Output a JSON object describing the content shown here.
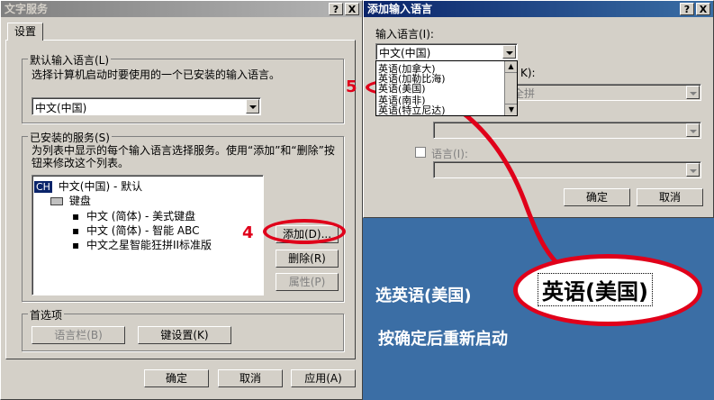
{
  "left_window": {
    "title": "文字服务",
    "title_buttons": [
      "?",
      "X"
    ],
    "tab": "设置",
    "default_lang": {
      "legend": "默认输入语言(L)",
      "description": "选择计算机启动时要使用的一个已安装的输入语言。",
      "value": "中文(中国)"
    },
    "installed": {
      "legend": "已安装的服务(S)",
      "description": "为列表中显示的每个输入语言选择服务。使用“添加”和“删除”按钮来修改这个列表。",
      "lang_code": "CH",
      "lang_name": "中文(中国) - 默认",
      "category": "键盘",
      "services": [
        "中文 (简体) - 美式键盘",
        "中文 (简体) - 智能 ABC",
        "中文之星智能狂拼II标准版"
      ],
      "add_label": "添加(D)...",
      "remove_label": "删除(R)",
      "props_label": "属性(P)"
    },
    "prefs": {
      "legend": "首选项",
      "langbar_label": "语言栏(B)",
      "keys_label": "键设置(K)"
    },
    "ok_label": "确定",
    "cancel_label": "取消",
    "apply_label": "应用(A)"
  },
  "right_window": {
    "title": "添加输入语言",
    "title_buttons": [
      "?",
      "X"
    ],
    "input_lang_label": "输入语言(I):",
    "input_lang_value": "中文(中国)",
    "dropdown_items": [
      "英语(加拿大)",
      "英语(加勒比海)",
      "英语(美国)",
      "英语(南非)",
      "英语(特立尼达)"
    ],
    "layout_label_fragment": "K):",
    "layout_value_fragment": "全拼",
    "ime_label": "语言(I):",
    "ok_label": "确定",
    "cancel_label": "取消"
  },
  "annotations": {
    "step4": "4",
    "step5": "5",
    "choose_text": "选英语(美国)",
    "restart_text": "按确定后重新启动",
    "zoom_lines": [
      "英语(美国)"
    ]
  },
  "colors": {
    "desktop": "#3b6ea5",
    "highlight": "#e0001a"
  }
}
